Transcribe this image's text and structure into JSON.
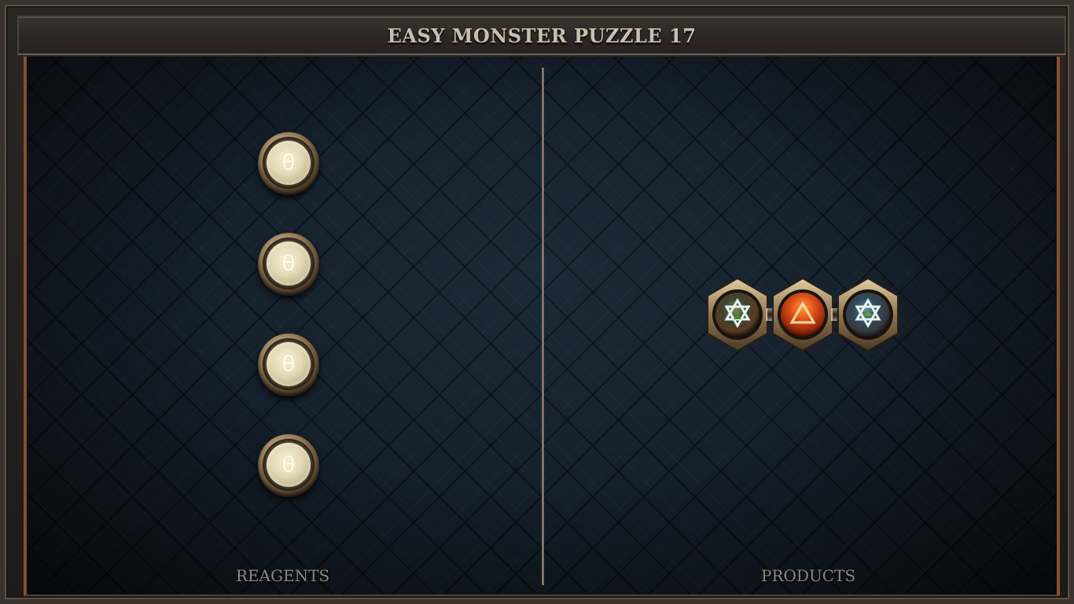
{
  "title": "EASY MONSTER PUZZLE 17",
  "reagents": {
    "label": "REAGENTS",
    "items": [
      {
        "symbol": "θ"
      },
      {
        "symbol": "θ"
      },
      {
        "symbol": "θ"
      },
      {
        "symbol": "θ"
      }
    ]
  },
  "products": {
    "label": "PRODUCTS",
    "molecule": {
      "atoms": [
        {
          "glyph": "hexagram-icon",
          "color": "#3f6a3a"
        },
        {
          "glyph": "triangle-icon",
          "color": "#d14a12"
        },
        {
          "glyph": "hexagram-icon",
          "color": "#2f5a78"
        }
      ],
      "bonds": 2
    }
  },
  "colors": {
    "board": "#121c26",
    "frame": "#2b2622",
    "accent_rail": "#8a4f2a",
    "title_text": "#c9bfb1",
    "label_text": "#8f8880"
  }
}
